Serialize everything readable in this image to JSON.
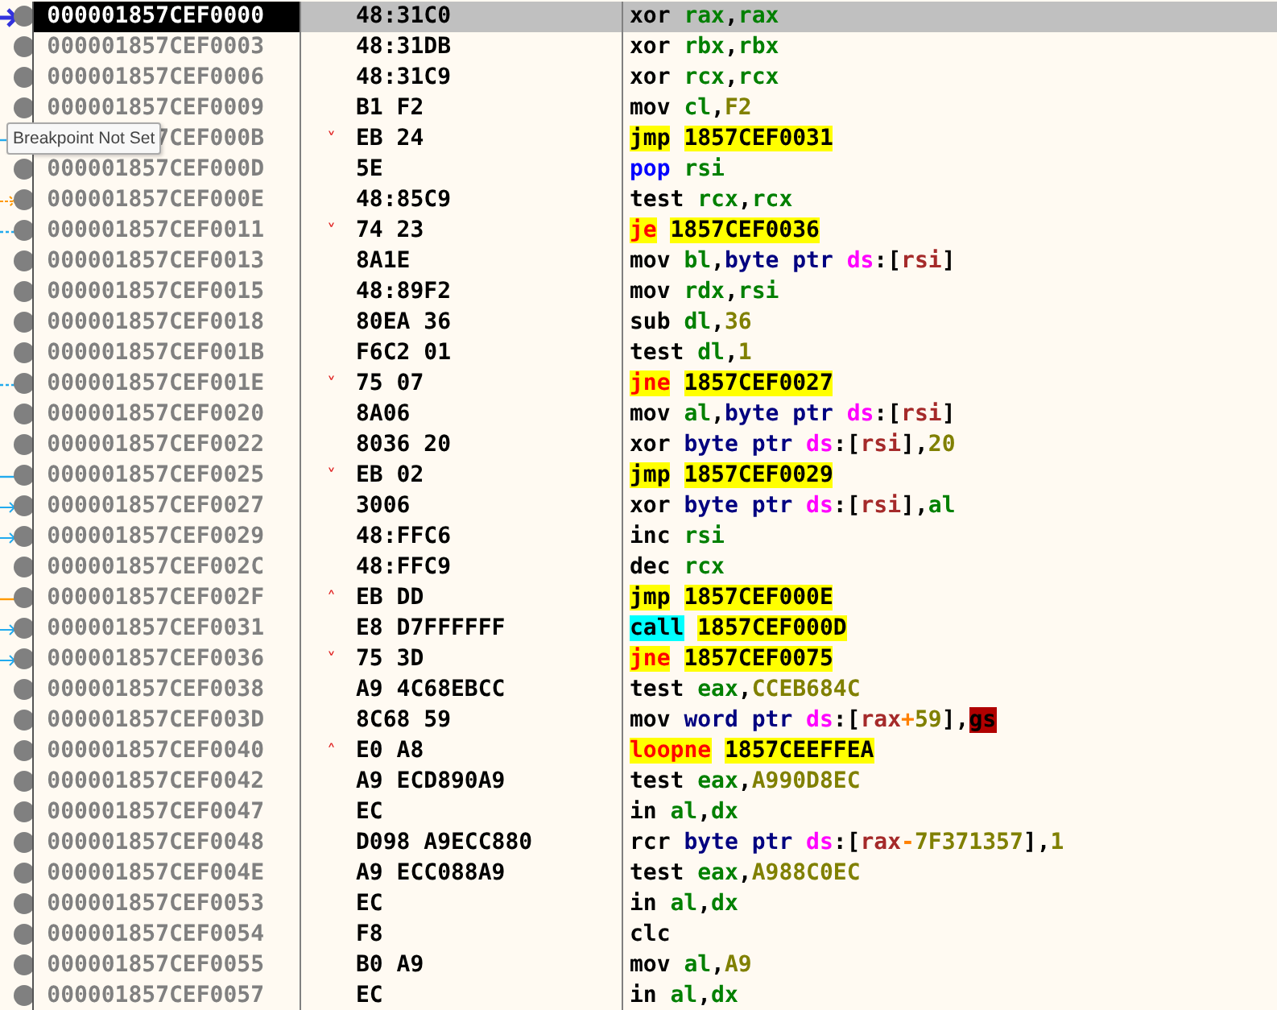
{
  "tooltip": "Breakpoint Not Set",
  "rows": [
    {
      "selected": true,
      "address": "000001857CEF0000",
      "bytes": "48:31C0",
      "gutter": {
        "kind": "rip",
        "color": "#3333dd",
        "dashed": false
      },
      "mnemonic": {
        "t": "xor",
        "kind": "plain"
      },
      "operands": [
        {
          "t": "rax",
          "kind": "reg"
        },
        {
          "t": ",",
          "kind": "punct"
        },
        {
          "t": "rax",
          "kind": "reg"
        }
      ]
    },
    {
      "selected": false,
      "address": "000001857CEF0003",
      "bytes": "48:31DB",
      "mnemonic": {
        "t": "xor",
        "kind": "plain"
      },
      "operands": [
        {
          "t": "rbx",
          "kind": "reg"
        },
        {
          "t": ",",
          "kind": "punct"
        },
        {
          "t": "rbx",
          "kind": "reg"
        }
      ]
    },
    {
      "selected": false,
      "address": "000001857CEF0006",
      "bytes": "48:31C9",
      "mnemonic": {
        "t": "xor",
        "kind": "plain"
      },
      "operands": [
        {
          "t": "rcx",
          "kind": "reg"
        },
        {
          "t": ",",
          "kind": "punct"
        },
        {
          "t": "rcx",
          "kind": "reg"
        }
      ]
    },
    {
      "selected": false,
      "address": "000001857CEF0009",
      "bytes": "B1 F2",
      "mnemonic": {
        "t": "mov",
        "kind": "plain"
      },
      "operands": [
        {
          "t": "cl",
          "kind": "reg"
        },
        {
          "t": ",",
          "kind": "punct"
        },
        {
          "t": "F2",
          "kind": "imm"
        }
      ]
    },
    {
      "selected": false,
      "address": "7CEF000B",
      "covered": true,
      "bytes": "EB 24",
      "jump": "˅",
      "gutter": {
        "kind": "out",
        "color": "#22aaee",
        "dashed": false
      },
      "mnemonic": {
        "t": "jmp",
        "kind": "jmp"
      },
      "operands": [
        {
          "t": "1857CEF0031",
          "kind": "target"
        }
      ]
    },
    {
      "selected": false,
      "address": "000001857CEF000D",
      "bytes": "5E",
      "mnemonic": {
        "t": "pop",
        "kind": "stack"
      },
      "operands": [
        {
          "t": "rsi",
          "kind": "reg"
        }
      ]
    },
    {
      "selected": false,
      "address": "000001857CEF000E",
      "bytes": "48:85C9",
      "gutter": {
        "kind": "in",
        "color": "#ff9900",
        "dashed": true
      },
      "mnemonic": {
        "t": "test",
        "kind": "plain"
      },
      "operands": [
        {
          "t": "rcx",
          "kind": "reg"
        },
        {
          "t": ",",
          "kind": "punct"
        },
        {
          "t": "rcx",
          "kind": "reg"
        }
      ]
    },
    {
      "selected": false,
      "address": "000001857CEF0011",
      "bytes": "74 23",
      "jump": "˅",
      "gutter": {
        "kind": "out",
        "color": "#22aaee",
        "dashed": true
      },
      "mnemonic": {
        "t": "je",
        "kind": "jcc"
      },
      "operands": [
        {
          "t": "1857CEF0036",
          "kind": "target"
        }
      ]
    },
    {
      "selected": false,
      "address": "000001857CEF0013",
      "bytes": "8A1E",
      "mnemonic": {
        "t": "mov",
        "kind": "plain"
      },
      "operands": [
        {
          "t": "bl",
          "kind": "reg",
          "tail": ","
        },
        {
          "t": "byte ptr",
          "kind": "size"
        },
        {
          "t": "ds",
          "kind": "seg"
        },
        {
          "t": ":[",
          "kind": "punct"
        },
        {
          "t": "rsi",
          "kind": "mreg"
        },
        {
          "t": "]",
          "kind": "punct"
        }
      ]
    },
    {
      "selected": false,
      "address": "000001857CEF0015",
      "bytes": "48:89F2",
      "mnemonic": {
        "t": "mov",
        "kind": "plain"
      },
      "operands": [
        {
          "t": "rdx",
          "kind": "reg"
        },
        {
          "t": ",",
          "kind": "punct"
        },
        {
          "t": "rsi",
          "kind": "reg"
        }
      ]
    },
    {
      "selected": false,
      "address": "000001857CEF0018",
      "bytes": "80EA 36",
      "mnemonic": {
        "t": "sub",
        "kind": "plain"
      },
      "operands": [
        {
          "t": "dl",
          "kind": "reg"
        },
        {
          "t": ",",
          "kind": "punct"
        },
        {
          "t": "36",
          "kind": "imm"
        }
      ]
    },
    {
      "selected": false,
      "address": "000001857CEF001B",
      "bytes": "F6C2 01",
      "mnemonic": {
        "t": "test",
        "kind": "plain"
      },
      "operands": [
        {
          "t": "dl",
          "kind": "reg"
        },
        {
          "t": ",",
          "kind": "punct"
        },
        {
          "t": "1",
          "kind": "imm"
        }
      ]
    },
    {
      "selected": false,
      "address": "000001857CEF001E",
      "bytes": "75 07",
      "jump": "˅",
      "gutter": {
        "kind": "out",
        "color": "#22aaee",
        "dashed": true
      },
      "mnemonic": {
        "t": "jne",
        "kind": "jcc"
      },
      "operands": [
        {
          "t": "1857CEF0027",
          "kind": "target"
        }
      ]
    },
    {
      "selected": false,
      "address": "000001857CEF0020",
      "bytes": "8A06",
      "mnemonic": {
        "t": "mov",
        "kind": "plain"
      },
      "operands": [
        {
          "t": "al",
          "kind": "reg",
          "tail": ","
        },
        {
          "t": "byte ptr",
          "kind": "size"
        },
        {
          "t": "ds",
          "kind": "seg"
        },
        {
          "t": ":[",
          "kind": "punct"
        },
        {
          "t": "rsi",
          "kind": "mreg"
        },
        {
          "t": "]",
          "kind": "punct"
        }
      ]
    },
    {
      "selected": false,
      "address": "000001857CEF0022",
      "bytes": "8036 20",
      "mnemonic": {
        "t": "xor",
        "kind": "plain"
      },
      "operands": [
        {
          "t": "byte ptr",
          "kind": "size"
        },
        {
          "t": "ds",
          "kind": "seg"
        },
        {
          "t": ":[",
          "kind": "punct"
        },
        {
          "t": "rsi",
          "kind": "mreg"
        },
        {
          "t": "],",
          "kind": "punct"
        },
        {
          "t": "20",
          "kind": "imm"
        }
      ]
    },
    {
      "selected": false,
      "address": "000001857CEF0025",
      "bytes": "EB 02",
      "jump": "˅",
      "gutter": {
        "kind": "out",
        "color": "#22aaee",
        "dashed": false
      },
      "mnemonic": {
        "t": "jmp",
        "kind": "jmp"
      },
      "operands": [
        {
          "t": "1857CEF0029",
          "kind": "target"
        }
      ]
    },
    {
      "selected": false,
      "address": "000001857CEF0027",
      "bytes": "3006",
      "gutter": {
        "kind": "in",
        "color": "#22aaee",
        "dashed": false
      },
      "mnemonic": {
        "t": "xor",
        "kind": "plain"
      },
      "operands": [
        {
          "t": "byte ptr",
          "kind": "size"
        },
        {
          "t": "ds",
          "kind": "seg"
        },
        {
          "t": ":[",
          "kind": "punct"
        },
        {
          "t": "rsi",
          "kind": "mreg"
        },
        {
          "t": "],",
          "kind": "punct"
        },
        {
          "t": "al",
          "kind": "reg"
        }
      ]
    },
    {
      "selected": false,
      "address": "000001857CEF0029",
      "bytes": "48:FFC6",
      "gutter": {
        "kind": "in",
        "color": "#22aaee",
        "dashed": false
      },
      "mnemonic": {
        "t": "inc",
        "kind": "plain"
      },
      "operands": [
        {
          "t": "rsi",
          "kind": "reg"
        }
      ]
    },
    {
      "selected": false,
      "address": "000001857CEF002C",
      "bytes": "48:FFC9",
      "mnemonic": {
        "t": "dec",
        "kind": "plain"
      },
      "operands": [
        {
          "t": "rcx",
          "kind": "reg"
        }
      ]
    },
    {
      "selected": false,
      "address": "000001857CEF002F",
      "bytes": "EB DD",
      "jump": "˄",
      "gutter": {
        "kind": "out",
        "color": "#ff9900",
        "dashed": false
      },
      "mnemonic": {
        "t": "jmp",
        "kind": "jmp"
      },
      "operands": [
        {
          "t": "1857CEF000E",
          "kind": "target"
        }
      ]
    },
    {
      "selected": false,
      "address": "000001857CEF0031",
      "bytes": "E8 D7FFFFFF",
      "gutter": {
        "kind": "in",
        "color": "#22aaee",
        "dashed": false
      },
      "mnemonic": {
        "t": "call",
        "kind": "call"
      },
      "operands": [
        {
          "t": "1857CEF000D",
          "kind": "target"
        }
      ]
    },
    {
      "selected": false,
      "address": "000001857CEF0036",
      "bytes": "75 3D",
      "jump": "˅",
      "gutter": {
        "kind": "in",
        "color": "#22aaee",
        "dashed": false
      },
      "mnemonic": {
        "t": "jne",
        "kind": "jcc"
      },
      "operands": [
        {
          "t": "1857CEF0075",
          "kind": "target"
        }
      ]
    },
    {
      "selected": false,
      "address": "000001857CEF0038",
      "bytes": "A9 4C68EBCC",
      "mnemonic": {
        "t": "test",
        "kind": "plain"
      },
      "operands": [
        {
          "t": "eax",
          "kind": "reg"
        },
        {
          "t": ",",
          "kind": "punct"
        },
        {
          "t": "CCEB684C",
          "kind": "imm"
        }
      ]
    },
    {
      "selected": false,
      "address": "000001857CEF003D",
      "bytes": "8C68 59",
      "mnemonic": {
        "t": "mov",
        "kind": "plain"
      },
      "operands": [
        {
          "t": "word ptr",
          "kind": "size"
        },
        {
          "t": "ds",
          "kind": "seg"
        },
        {
          "t": ":[",
          "kind": "punct"
        },
        {
          "t": "rax",
          "kind": "mreg"
        },
        {
          "t": "+",
          "kind": "op"
        },
        {
          "t": "59",
          "kind": "imm"
        },
        {
          "t": "],",
          "kind": "punct"
        },
        {
          "t": "gs",
          "kind": "sreg"
        }
      ]
    },
    {
      "selected": false,
      "address": "000001857CEF0040",
      "bytes": "E0 A8",
      "jump": "˄",
      "mnemonic": {
        "t": "loopne",
        "kind": "jcc"
      },
      "operands": [
        {
          "t": "1857CEEFFEA",
          "kind": "target"
        }
      ]
    },
    {
      "selected": false,
      "address": "000001857CEF0042",
      "bytes": "A9 ECD890A9",
      "mnemonic": {
        "t": "test",
        "kind": "plain"
      },
      "operands": [
        {
          "t": "eax",
          "kind": "reg"
        },
        {
          "t": ",",
          "kind": "punct"
        },
        {
          "t": "A990D8EC",
          "kind": "imm"
        }
      ]
    },
    {
      "selected": false,
      "address": "000001857CEF0047",
      "bytes": "EC",
      "mnemonic": {
        "t": "in",
        "kind": "plain"
      },
      "operands": [
        {
          "t": "al",
          "kind": "reg"
        },
        {
          "t": ",",
          "kind": "punct"
        },
        {
          "t": "dx",
          "kind": "reg"
        }
      ]
    },
    {
      "selected": false,
      "address": "000001857CEF0048",
      "bytes": "D098 A9ECC880",
      "mnemonic": {
        "t": "rcr",
        "kind": "plain"
      },
      "operands": [
        {
          "t": "byte ptr",
          "kind": "size"
        },
        {
          "t": "ds",
          "kind": "seg"
        },
        {
          "t": ":[",
          "kind": "punct"
        },
        {
          "t": "rax",
          "kind": "mreg"
        },
        {
          "t": "-",
          "kind": "op"
        },
        {
          "t": "7F371357",
          "kind": "imm"
        },
        {
          "t": "],",
          "kind": "punct"
        },
        {
          "t": "1",
          "kind": "imm"
        }
      ]
    },
    {
      "selected": false,
      "address": "000001857CEF004E",
      "bytes": "A9 ECC088A9",
      "mnemonic": {
        "t": "test",
        "kind": "plain"
      },
      "operands": [
        {
          "t": "eax",
          "kind": "reg"
        },
        {
          "t": ",",
          "kind": "punct"
        },
        {
          "t": "A988C0EC",
          "kind": "imm"
        }
      ]
    },
    {
      "selected": false,
      "address": "000001857CEF0053",
      "bytes": "EC",
      "mnemonic": {
        "t": "in",
        "kind": "plain"
      },
      "operands": [
        {
          "t": "al",
          "kind": "reg"
        },
        {
          "t": ",",
          "kind": "punct"
        },
        {
          "t": "dx",
          "kind": "reg"
        }
      ]
    },
    {
      "selected": false,
      "address": "000001857CEF0054",
      "bytes": "F8",
      "mnemonic": {
        "t": "clc",
        "kind": "plain"
      },
      "operands": []
    },
    {
      "selected": false,
      "address": "000001857CEF0055",
      "bytes": "B0 A9",
      "mnemonic": {
        "t": "mov",
        "kind": "plain"
      },
      "operands": [
        {
          "t": "al",
          "kind": "reg"
        },
        {
          "t": ",",
          "kind": "punct"
        },
        {
          "t": "A9",
          "kind": "imm"
        }
      ]
    },
    {
      "selected": false,
      "address": "000001857CEF0057",
      "bytes": "EC",
      "mnemonic": {
        "t": "in",
        "kind": "plain"
      },
      "operands": [
        {
          "t": "al",
          "kind": "reg"
        },
        {
          "t": ",",
          "kind": "punct"
        },
        {
          "t": "dx",
          "kind": "reg"
        }
      ]
    }
  ]
}
